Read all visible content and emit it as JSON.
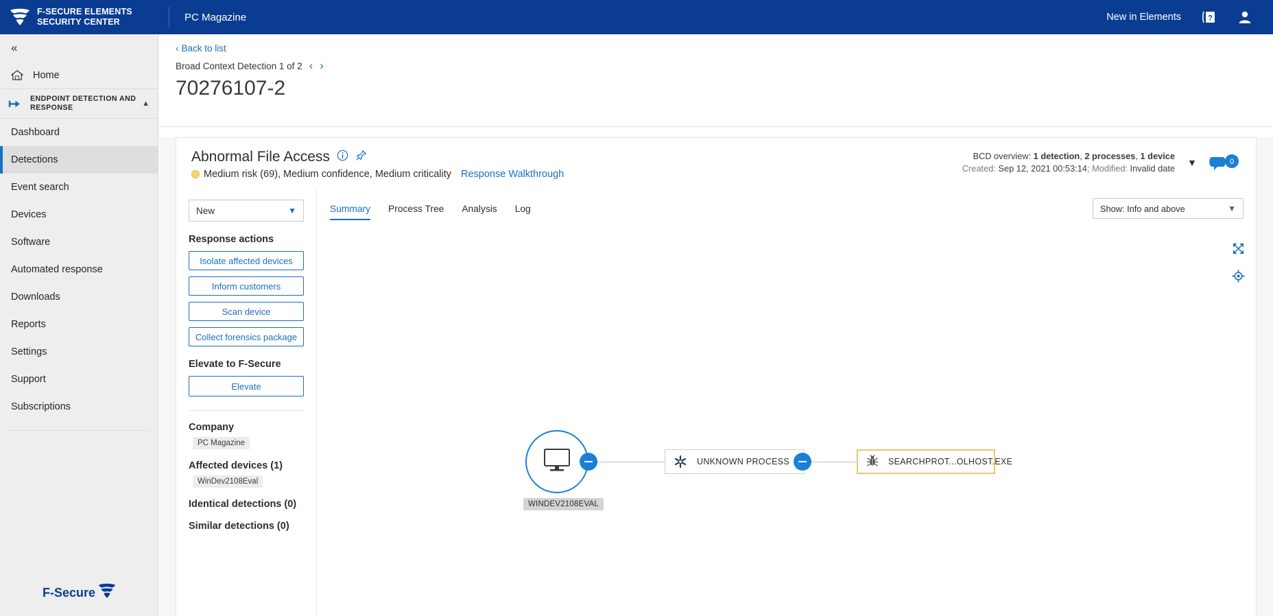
{
  "topbar": {
    "brand_line1": "F-SECURE ELEMENTS",
    "brand_line2": "SECURITY CENTER",
    "company": "PC Magazine",
    "new_in_elements": "New in Elements",
    "help_icon": "help-icon",
    "account_icon": "account-icon"
  },
  "sidebar": {
    "collapse_icon": "«",
    "home": "Home",
    "section_label": "ENDPOINT DETECTION AND RESPONSE",
    "items": [
      {
        "label": "Dashboard",
        "active": false
      },
      {
        "label": "Detections",
        "active": true
      },
      {
        "label": "Event search",
        "active": false
      },
      {
        "label": "Devices",
        "active": false
      },
      {
        "label": "Software",
        "active": false
      },
      {
        "label": "Automated response",
        "active": false
      },
      {
        "label": "Downloads",
        "active": false
      },
      {
        "label": "Reports",
        "active": false
      },
      {
        "label": "Settings",
        "active": false
      },
      {
        "label": "Support",
        "active": false
      },
      {
        "label": "Subscriptions",
        "active": false
      }
    ],
    "footer_logo_text": "F-Secure"
  },
  "page_head": {
    "back_label": "Back to list",
    "bcd_label": "Broad Context Detection 1 of 2",
    "prev_arrow": "‹",
    "next_arrow": "›",
    "title": "70276107-2"
  },
  "detection": {
    "title": "Abnormal File Access",
    "risk_line": "Medium risk (69), Medium confidence, Medium criticality",
    "walkthrough": "Response Walkthrough",
    "overview_prefix": "BCD overview: ",
    "overview_detections": "1 detection",
    "overview_processes": "2 processes",
    "overview_devices": "1 device",
    "created_prefix": "Created: ",
    "created_value": "Sep 12, 2021 00:53:14",
    "modified_prefix": "Modified: ",
    "modified_value": "Invalid date",
    "comment_count": "0",
    "risk_color": "#f5d76e"
  },
  "left_panel": {
    "status_value": "New",
    "response_actions_title": "Response actions",
    "actions": [
      "Isolate affected devices",
      "Inform customers",
      "Scan device",
      "Collect forensics package"
    ],
    "elevate_title": "Elevate to F-Secure",
    "elevate_button": "Elevate",
    "company_title": "Company",
    "company_value": "PC Magazine",
    "affected_devices_title": "Affected devices (1)",
    "affected_device_value": "WinDev2108Eval",
    "identical_detections_title": "Identical detections (0)",
    "similar_detections_title": "Similar detections (0)"
  },
  "main": {
    "tabs": [
      {
        "label": "Summary",
        "active": true
      },
      {
        "label": "Process Tree",
        "active": false
      },
      {
        "label": "Analysis",
        "active": false
      },
      {
        "label": "Log",
        "active": false
      }
    ],
    "show_filter": "Show: Info and above",
    "tools": [
      {
        "name": "expand-icon"
      },
      {
        "name": "recenter-icon"
      }
    ]
  },
  "graph": {
    "device_node": {
      "icon": "monitor-icon",
      "label": "WINDEV2108EVAL"
    },
    "nodes": [
      {
        "icon": "unknown-process-icon",
        "label": "UNKNOWN PROCESS",
        "selected": false
      },
      {
        "icon": "bug-icon",
        "label": "SEARCHPROT...OLHOST.EXE",
        "selected": true
      }
    ]
  }
}
